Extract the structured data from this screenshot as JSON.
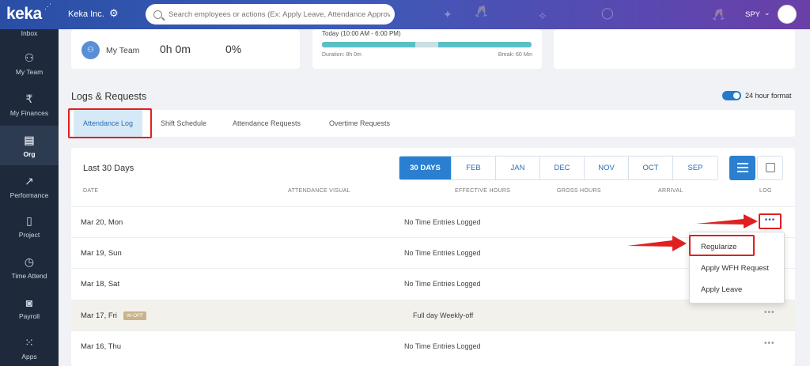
{
  "header": {
    "logo": "keka",
    "org_name": "Keka Inc.",
    "search_placeholder": "Search employees or actions (Ex: Apply Leave, Attendance Approvals)",
    "user_code": "SPY"
  },
  "sidebar": {
    "items": [
      {
        "label": "Inbox",
        "icon": "inbox-icon"
      },
      {
        "label": "My Team",
        "icon": "team-icon"
      },
      {
        "label": "My Finances",
        "icon": "rupee-icon"
      },
      {
        "label": "Org",
        "icon": "org-icon"
      },
      {
        "label": "Performance",
        "icon": "chart-icon"
      },
      {
        "label": "Project",
        "icon": "clipboard-icon"
      },
      {
        "label": "Time Attend",
        "icon": "clock-icon"
      },
      {
        "label": "Payroll",
        "icon": "payroll-icon"
      },
      {
        "label": "Apps",
        "icon": "grid-icon"
      }
    ],
    "active": "Org"
  },
  "summary": {
    "team_label": "My Team",
    "team_time": "0h 0m",
    "team_pct": "0%",
    "shift_title": "Today (10:00 AM - 6:00 PM)",
    "shift_duration": "Duration: 8h 0m",
    "shift_break": "Break: 60 Min"
  },
  "logs": {
    "title": "Logs & Requests",
    "toggle_label": "24 hour format",
    "tabs": [
      "Attendance Log",
      "Shift Schedule",
      "Attendance Requests",
      "Overtime Requests"
    ],
    "period_title": "Last 30 Days",
    "filters": [
      "30 DAYS",
      "FEB",
      "JAN",
      "DEC",
      "NOV",
      "OCT",
      "SEP"
    ],
    "columns": [
      "DATE",
      "ATTENDANCE VISUAL",
      "EFFECTIVE HOURS",
      "GROSS HOURS",
      "ARRIVAL",
      "LOG"
    ],
    "rows": [
      {
        "date": "Mar 20, Mon",
        "message": "No Time Entries Logged",
        "badge": ""
      },
      {
        "date": "Mar 19, Sun",
        "message": "No Time Entries Logged",
        "badge": ""
      },
      {
        "date": "Mar 18, Sat",
        "message": "No Time Entries Logged",
        "badge": ""
      },
      {
        "date": "Mar 17, Fri",
        "message": "Full day Weekly-off",
        "badge": "W-OFF"
      },
      {
        "date": "Mar 16, Thu",
        "message": "No Time Entries Logged",
        "badge": ""
      }
    ],
    "menu": [
      "Regularize",
      "Apply WFH Request",
      "Apply Leave"
    ],
    "more_glyph": "•••"
  },
  "colors": {
    "accent": "#2a7fd0",
    "sidebar_bg": "#1e2a3b",
    "highlight_red": "#e02020",
    "weekoff_bg": "#f3f1ec"
  }
}
